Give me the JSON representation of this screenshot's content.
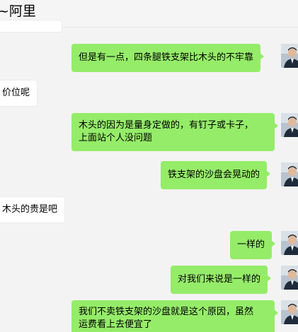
{
  "header": {
    "title": "~阿里"
  },
  "messages": [
    {
      "side": "in",
      "text": ""
    },
    {
      "side": "out",
      "text": "但是有一点，四条腿铁支架比木头的不牢靠"
    },
    {
      "side": "in",
      "text": "价位呢"
    },
    {
      "side": "out",
      "lines": [
        "木头的因为是量身定做的，有钉子或卡子，",
        "上面站个人没问题"
      ]
    },
    {
      "side": "out",
      "text": "铁支架的沙盘会晃动的"
    },
    {
      "side": "in",
      "text": "木头的贵是吧"
    },
    {
      "side": "out",
      "text": "一样的"
    },
    {
      "side": "out",
      "text": "对我们来说是一样的"
    },
    {
      "side": "out",
      "lines": [
        "我们不卖铁支架的沙盘就是这个原因，虽然",
        "运费看上去便宜了"
      ]
    }
  ],
  "colors": {
    "outgoing_bubble": "#95ec69",
    "incoming_bubble": "#ffffff",
    "background": "#f3f3f3"
  },
  "avatar_icon": "user-avatar-photo"
}
